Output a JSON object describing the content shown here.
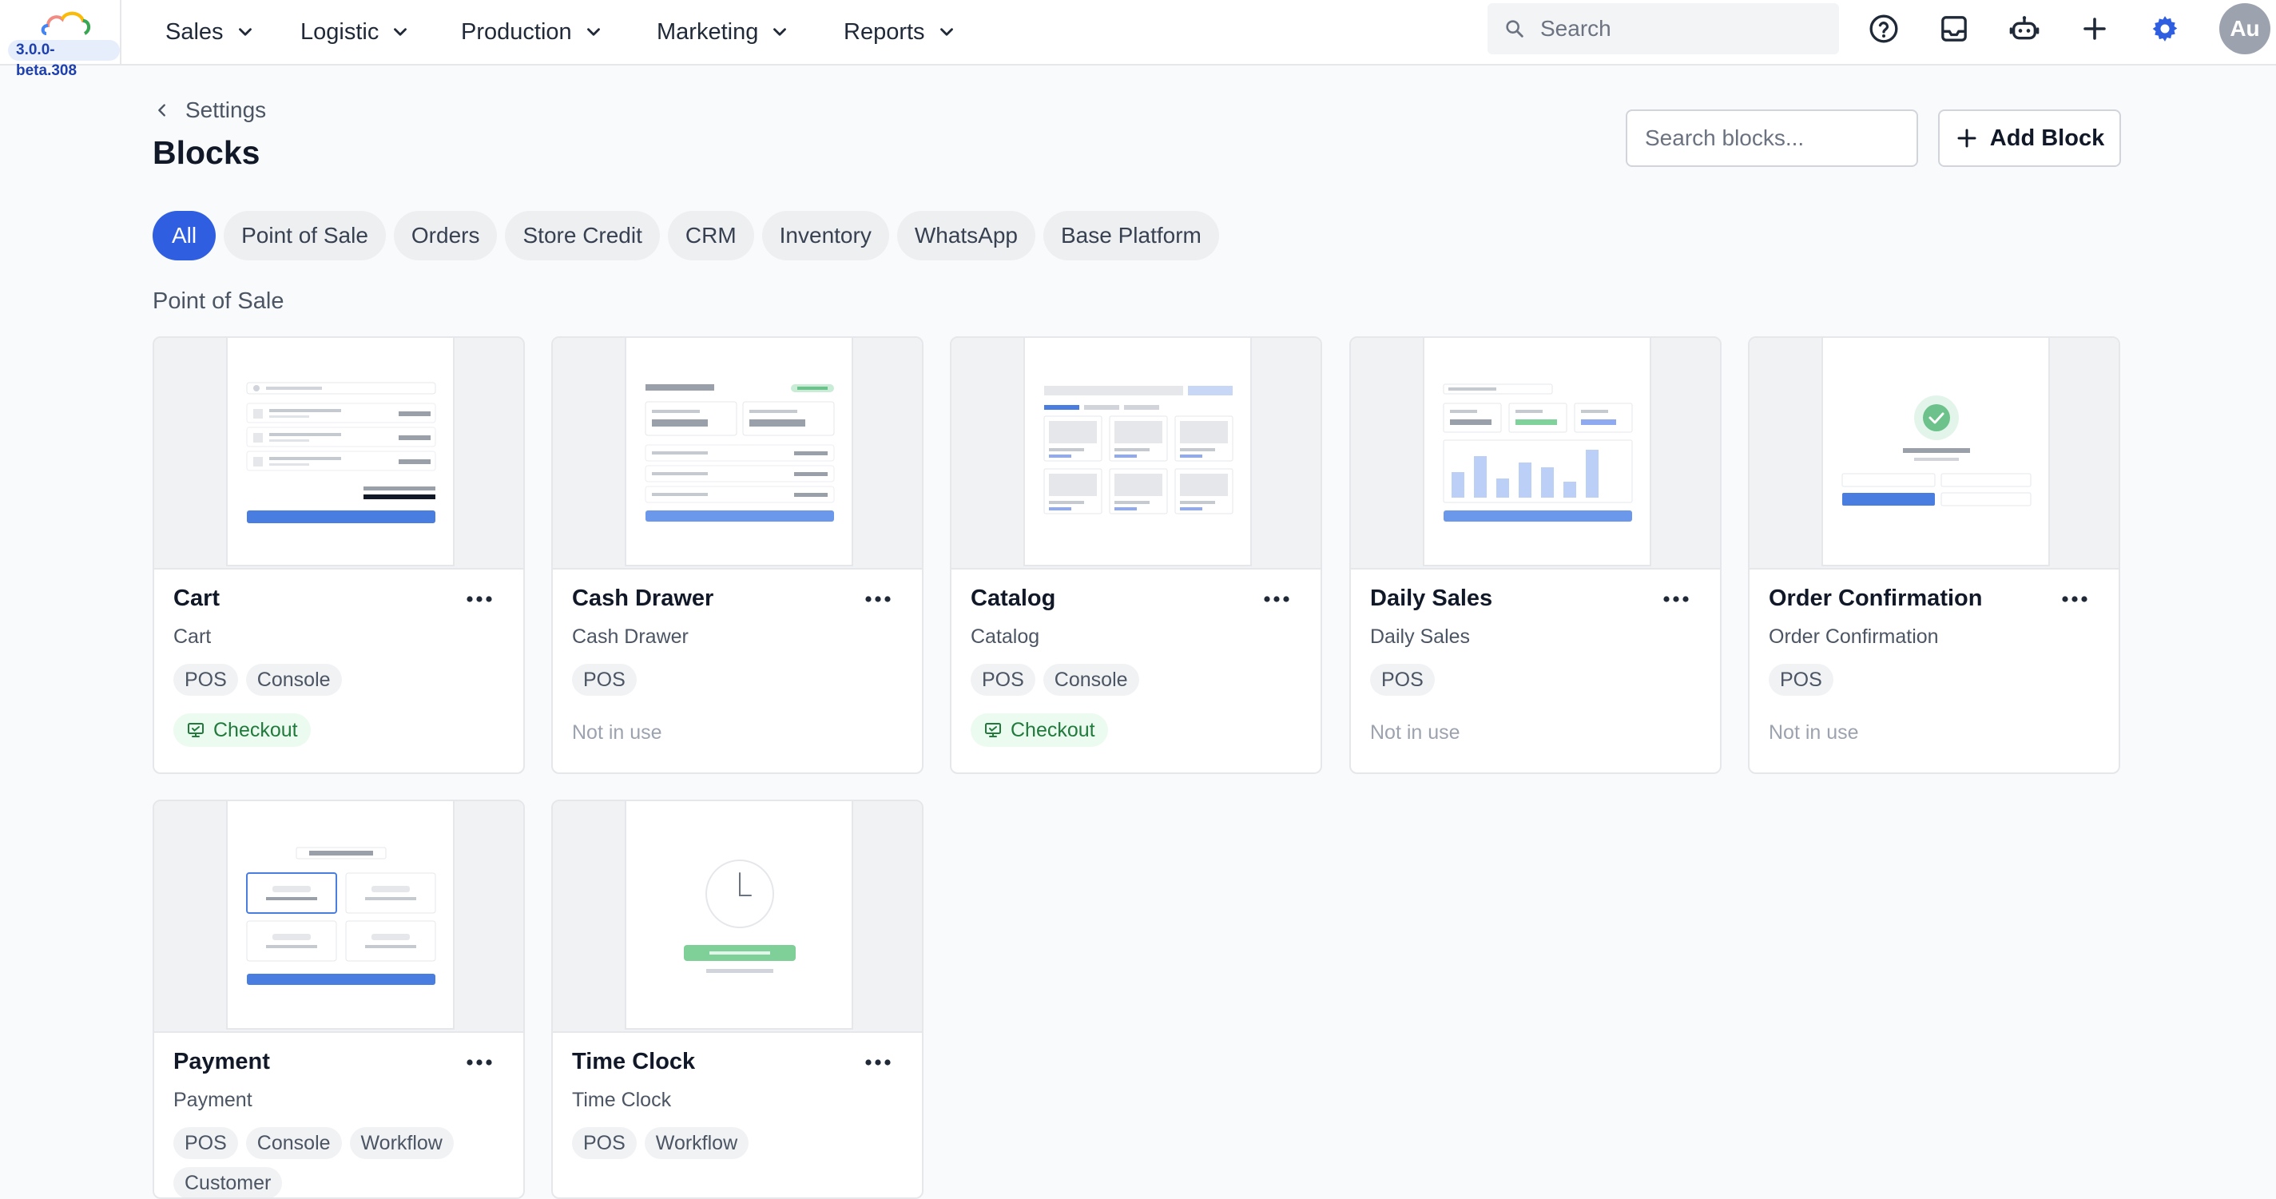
{
  "app": {
    "version": "3.0.0-beta.308",
    "nav": [
      {
        "label": "Sales"
      },
      {
        "label": "Logistic"
      },
      {
        "label": "Production"
      },
      {
        "label": "Marketing"
      },
      {
        "label": "Reports"
      }
    ],
    "search_placeholder": "Search",
    "avatar_initials": "Au",
    "accent_color": "#2f5fe0"
  },
  "header": {
    "breadcrumb": "Settings",
    "title": "Blocks",
    "search_placeholder": "Search blocks...",
    "add_button": "Add Block"
  },
  "filters": [
    {
      "label": "All",
      "active": true
    },
    {
      "label": "Point of Sale"
    },
    {
      "label": "Orders"
    },
    {
      "label": "Store Credit"
    },
    {
      "label": "CRM"
    },
    {
      "label": "Inventory"
    },
    {
      "label": "WhatsApp"
    },
    {
      "label": "Base Platform"
    }
  ],
  "section": {
    "title": "Point of Sale"
  },
  "blocks": [
    {
      "name": "Cart",
      "subtitle": "Cart",
      "tags": [
        "POS",
        "Console"
      ],
      "usage": "Checkout",
      "in_use": true,
      "preview": "cart"
    },
    {
      "name": "Cash Drawer",
      "subtitle": "Cash Drawer",
      "tags": [
        "POS"
      ],
      "usage": "Not in use",
      "in_use": false,
      "preview": "cash-drawer"
    },
    {
      "name": "Catalog",
      "subtitle": "Catalog",
      "tags": [
        "POS",
        "Console"
      ],
      "usage": "Checkout",
      "in_use": true,
      "preview": "catalog"
    },
    {
      "name": "Daily Sales",
      "subtitle": "Daily Sales",
      "tags": [
        "POS"
      ],
      "usage": "Not in use",
      "in_use": false,
      "preview": "daily-sales"
    },
    {
      "name": "Order Confirmation",
      "subtitle": "Order Confirmation",
      "tags": [
        "POS"
      ],
      "usage": "Not in use",
      "in_use": false,
      "preview": "order-confirmation"
    },
    {
      "name": "Payment",
      "subtitle": "Payment",
      "tags": [
        "POS",
        "Console",
        "Workflow",
        "Customer"
      ],
      "usage": "",
      "preview": "payment"
    },
    {
      "name": "Time Clock",
      "subtitle": "Time Clock",
      "tags": [
        "POS",
        "Workflow"
      ],
      "usage": "",
      "preview": "time-clock"
    }
  ]
}
